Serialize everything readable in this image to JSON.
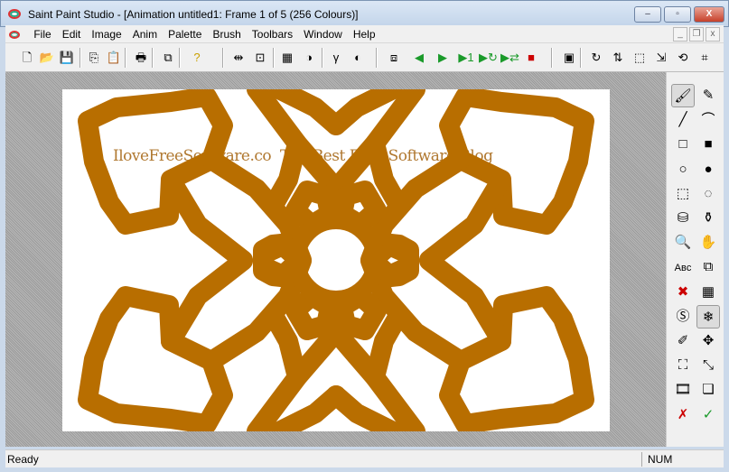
{
  "window": {
    "title": "Saint Paint Studio - [Animation untitled1: Frame 1 of 5 (256 Colours)]",
    "min": "–",
    "max": "▫",
    "close": "X"
  },
  "menu": [
    "File",
    "Edit",
    "Image",
    "Anim",
    "Palette",
    "Brush",
    "Toolbars",
    "Window",
    "Help"
  ],
  "mdi": {
    "min": "_",
    "restore": "❐",
    "close": "x"
  },
  "toolbar": [
    {
      "icon": "new-file-icon",
      "glyph": "🗋"
    },
    {
      "icon": "open-folder-icon",
      "glyph": "📂"
    },
    {
      "icon": "save-icon",
      "glyph": "💾"
    },
    {
      "icon": "copy-icon",
      "glyph": "⎘"
    },
    {
      "icon": "paste-icon",
      "glyph": "📋"
    },
    {
      "icon": "print-icon",
      "glyph": "🖶"
    },
    {
      "icon": "window-icon",
      "glyph": "⧉"
    },
    {
      "icon": "help-icon",
      "glyph": "?"
    },
    {
      "icon": "resize-icon",
      "glyph": "⇹"
    },
    {
      "icon": "crop-icon",
      "glyph": "⊡"
    },
    {
      "icon": "palette-icon",
      "glyph": "▦"
    },
    {
      "icon": "contrast-icon",
      "glyph": "◑"
    },
    {
      "icon": "gamma-icon",
      "glyph": "γ"
    },
    {
      "icon": "invert-icon",
      "glyph": "◐"
    },
    {
      "icon": "frames-icon",
      "glyph": "⧈"
    },
    {
      "icon": "prev-frame-icon",
      "glyph": "◀"
    },
    {
      "icon": "next-frame-icon",
      "glyph": "▶"
    },
    {
      "icon": "play-once-icon",
      "glyph": "▶1"
    },
    {
      "icon": "play-loop-icon",
      "glyph": "▶↻"
    },
    {
      "icon": "play-pingpong-icon",
      "glyph": "▶⇄"
    },
    {
      "icon": "stop-icon",
      "glyph": "■"
    },
    {
      "icon": "view-icon",
      "glyph": "▣"
    },
    {
      "icon": "rotate-icon",
      "glyph": "↻"
    },
    {
      "icon": "flip-icon",
      "glyph": "⇅"
    },
    {
      "icon": "select-all-icon",
      "glyph": "⬚"
    },
    {
      "icon": "transform-icon",
      "glyph": "⇲"
    },
    {
      "icon": "rotate-free-icon",
      "glyph": "⟲"
    },
    {
      "icon": "crop-frame-icon",
      "glyph": "⌗"
    }
  ],
  "canvas": {
    "watermark": "IloveFreeSoftware.co  The Best Free Software Blog",
    "stroke_color": "#b86e00"
  },
  "tools": [
    {
      "icon": "brush-icon",
      "glyph": "🖌",
      "selected": true
    },
    {
      "icon": "eyedropper-icon",
      "glyph": "✎"
    },
    {
      "icon": "line-icon",
      "glyph": "╱"
    },
    {
      "icon": "curve-icon",
      "glyph": "⌒"
    },
    {
      "icon": "rectangle-icon",
      "glyph": "□"
    },
    {
      "icon": "filled-rectangle-icon",
      "glyph": "■"
    },
    {
      "icon": "ellipse-icon",
      "glyph": "○"
    },
    {
      "icon": "filled-ellipse-icon",
      "glyph": "●"
    },
    {
      "icon": "rect-select-icon",
      "glyph": "⬚"
    },
    {
      "icon": "lasso-icon",
      "glyph": "◌"
    },
    {
      "icon": "fill-icon",
      "glyph": "⛁"
    },
    {
      "icon": "spray-icon",
      "glyph": "⚱"
    },
    {
      "icon": "zoom-icon",
      "glyph": "🔍"
    },
    {
      "icon": "hand-icon",
      "glyph": "✋"
    },
    {
      "icon": "text-icon",
      "glyph": "Aʙᴄ"
    },
    {
      "icon": "stamp-icon",
      "glyph": "⧉"
    },
    {
      "icon": "erase-color-icon",
      "glyph": "✖"
    },
    {
      "icon": "palette-pick-icon",
      "glyph": "▦"
    },
    {
      "icon": "effect-icon",
      "glyph": "Ⓢ"
    },
    {
      "icon": "symmetry-icon",
      "glyph": "❄",
      "selected": true
    },
    {
      "icon": "fx-brush-icon",
      "glyph": "✐"
    },
    {
      "icon": "move-icon",
      "glyph": "✥"
    },
    {
      "icon": "resize-selection-icon",
      "glyph": "⛶"
    },
    {
      "icon": "shrink-icon",
      "glyph": "⤡"
    },
    {
      "icon": "film-icon",
      "glyph": "🎞"
    },
    {
      "icon": "layers-icon",
      "glyph": "❏"
    },
    {
      "icon": "cancel-icon",
      "glyph": "✗"
    },
    {
      "icon": "accept-icon",
      "glyph": "✓"
    }
  ],
  "status": {
    "text": "Ready",
    "num": "NUM"
  }
}
